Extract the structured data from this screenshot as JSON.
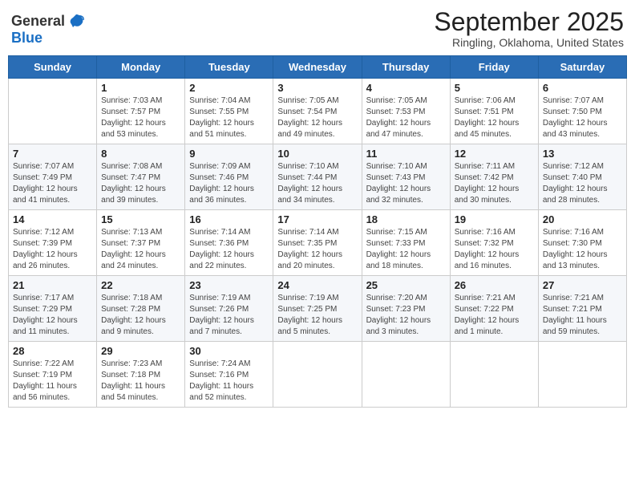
{
  "header": {
    "logo_general": "General",
    "logo_blue": "Blue",
    "month": "September 2025",
    "location": "Ringling, Oklahoma, United States"
  },
  "weekdays": [
    "Sunday",
    "Monday",
    "Tuesday",
    "Wednesday",
    "Thursday",
    "Friday",
    "Saturday"
  ],
  "weeks": [
    [
      {
        "day": "",
        "info": ""
      },
      {
        "day": "1",
        "info": "Sunrise: 7:03 AM\nSunset: 7:57 PM\nDaylight: 12 hours\nand 53 minutes."
      },
      {
        "day": "2",
        "info": "Sunrise: 7:04 AM\nSunset: 7:55 PM\nDaylight: 12 hours\nand 51 minutes."
      },
      {
        "day": "3",
        "info": "Sunrise: 7:05 AM\nSunset: 7:54 PM\nDaylight: 12 hours\nand 49 minutes."
      },
      {
        "day": "4",
        "info": "Sunrise: 7:05 AM\nSunset: 7:53 PM\nDaylight: 12 hours\nand 47 minutes."
      },
      {
        "day": "5",
        "info": "Sunrise: 7:06 AM\nSunset: 7:51 PM\nDaylight: 12 hours\nand 45 minutes."
      },
      {
        "day": "6",
        "info": "Sunrise: 7:07 AM\nSunset: 7:50 PM\nDaylight: 12 hours\nand 43 minutes."
      }
    ],
    [
      {
        "day": "7",
        "info": "Sunrise: 7:07 AM\nSunset: 7:49 PM\nDaylight: 12 hours\nand 41 minutes."
      },
      {
        "day": "8",
        "info": "Sunrise: 7:08 AM\nSunset: 7:47 PM\nDaylight: 12 hours\nand 39 minutes."
      },
      {
        "day": "9",
        "info": "Sunrise: 7:09 AM\nSunset: 7:46 PM\nDaylight: 12 hours\nand 36 minutes."
      },
      {
        "day": "10",
        "info": "Sunrise: 7:10 AM\nSunset: 7:44 PM\nDaylight: 12 hours\nand 34 minutes."
      },
      {
        "day": "11",
        "info": "Sunrise: 7:10 AM\nSunset: 7:43 PM\nDaylight: 12 hours\nand 32 minutes."
      },
      {
        "day": "12",
        "info": "Sunrise: 7:11 AM\nSunset: 7:42 PM\nDaylight: 12 hours\nand 30 minutes."
      },
      {
        "day": "13",
        "info": "Sunrise: 7:12 AM\nSunset: 7:40 PM\nDaylight: 12 hours\nand 28 minutes."
      }
    ],
    [
      {
        "day": "14",
        "info": "Sunrise: 7:12 AM\nSunset: 7:39 PM\nDaylight: 12 hours\nand 26 minutes."
      },
      {
        "day": "15",
        "info": "Sunrise: 7:13 AM\nSunset: 7:37 PM\nDaylight: 12 hours\nand 24 minutes."
      },
      {
        "day": "16",
        "info": "Sunrise: 7:14 AM\nSunset: 7:36 PM\nDaylight: 12 hours\nand 22 minutes."
      },
      {
        "day": "17",
        "info": "Sunrise: 7:14 AM\nSunset: 7:35 PM\nDaylight: 12 hours\nand 20 minutes."
      },
      {
        "day": "18",
        "info": "Sunrise: 7:15 AM\nSunset: 7:33 PM\nDaylight: 12 hours\nand 18 minutes."
      },
      {
        "day": "19",
        "info": "Sunrise: 7:16 AM\nSunset: 7:32 PM\nDaylight: 12 hours\nand 16 minutes."
      },
      {
        "day": "20",
        "info": "Sunrise: 7:16 AM\nSunset: 7:30 PM\nDaylight: 12 hours\nand 13 minutes."
      }
    ],
    [
      {
        "day": "21",
        "info": "Sunrise: 7:17 AM\nSunset: 7:29 PM\nDaylight: 12 hours\nand 11 minutes."
      },
      {
        "day": "22",
        "info": "Sunrise: 7:18 AM\nSunset: 7:28 PM\nDaylight: 12 hours\nand 9 minutes."
      },
      {
        "day": "23",
        "info": "Sunrise: 7:19 AM\nSunset: 7:26 PM\nDaylight: 12 hours\nand 7 minutes."
      },
      {
        "day": "24",
        "info": "Sunrise: 7:19 AM\nSunset: 7:25 PM\nDaylight: 12 hours\nand 5 minutes."
      },
      {
        "day": "25",
        "info": "Sunrise: 7:20 AM\nSunset: 7:23 PM\nDaylight: 12 hours\nand 3 minutes."
      },
      {
        "day": "26",
        "info": "Sunrise: 7:21 AM\nSunset: 7:22 PM\nDaylight: 12 hours\nand 1 minute."
      },
      {
        "day": "27",
        "info": "Sunrise: 7:21 AM\nSunset: 7:21 PM\nDaylight: 11 hours\nand 59 minutes."
      }
    ],
    [
      {
        "day": "28",
        "info": "Sunrise: 7:22 AM\nSunset: 7:19 PM\nDaylight: 11 hours\nand 56 minutes."
      },
      {
        "day": "29",
        "info": "Sunrise: 7:23 AM\nSunset: 7:18 PM\nDaylight: 11 hours\nand 54 minutes."
      },
      {
        "day": "30",
        "info": "Sunrise: 7:24 AM\nSunset: 7:16 PM\nDaylight: 11 hours\nand 52 minutes."
      },
      {
        "day": "",
        "info": ""
      },
      {
        "day": "",
        "info": ""
      },
      {
        "day": "",
        "info": ""
      },
      {
        "day": "",
        "info": ""
      }
    ]
  ]
}
